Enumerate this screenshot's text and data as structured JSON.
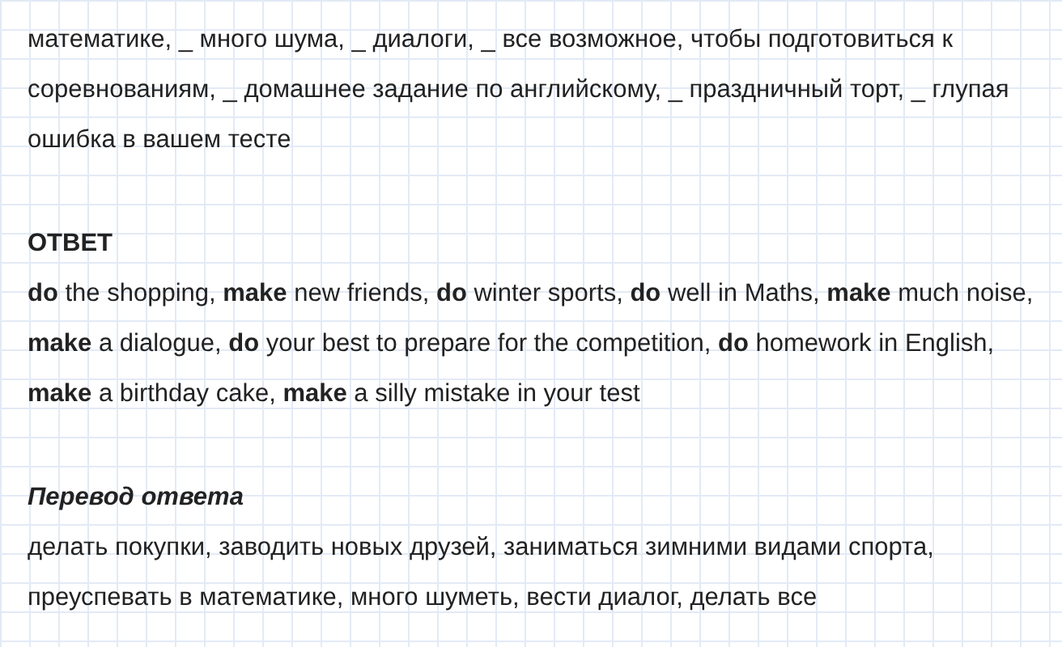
{
  "task_text": "математике, _ много шума, _ диалоги, _ все возможное, чтобы подготовиться к соревнованиям, _ домашнее задание по английскому, _ праздничный торт, _ глупая ошибка в вашем тесте",
  "answer_heading": "ОТВЕТ",
  "answer_text": "**do** the shopping, **make** new friends, **do** winter sports, **do** well in Maths, **make** much noise, **make** a dialogue, **do** your best to prepare for the competition, **do** homework in English, **make** a birthday cake, **make** a silly mistake in your test",
  "translation_heading": "Перевод ответа",
  "translation_text": "делать покупки, заводить новых друзей, заниматься зимними видами спорта, преуспевать в математике, много шуметь, вести диалог, делать все"
}
